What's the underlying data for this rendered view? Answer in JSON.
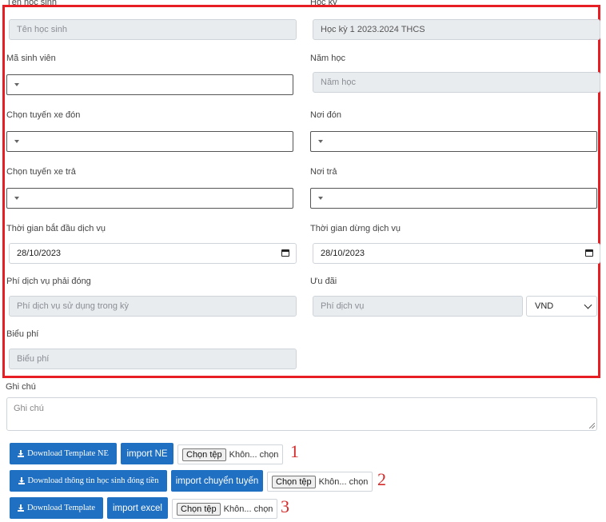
{
  "form": {
    "student_name": {
      "label": "Tên học sinh",
      "placeholder": "Tên học sinh"
    },
    "semester": {
      "label": "Học kỳ",
      "value": "Học kỳ 1 2023.2024 THCS"
    },
    "student_id": {
      "label": "Mã sinh viên"
    },
    "school_year": {
      "label": "Năm học",
      "placeholder": "Năm học"
    },
    "pickup_route": {
      "label": "Chọn tuyến xe đón"
    },
    "pickup_place": {
      "label": "Nơi đón"
    },
    "dropoff_route": {
      "label": "Chọn tuyến xe trả"
    },
    "dropoff_place": {
      "label": "Nơi trả"
    },
    "start_date": {
      "label": "Thời gian bắt đầu dịch vụ",
      "value": "28/10/2023"
    },
    "end_date": {
      "label": "Thời gian dừng dịch vụ",
      "value": "28/10/2023"
    },
    "fee": {
      "label": "Phí dịch vụ phải đóng",
      "placeholder": "Phí dịch vụ sử dụng  trong kỳ"
    },
    "discount": {
      "label": "Ưu đãi",
      "placeholder": "Phí dịch vụ",
      "currency": "VND"
    },
    "fee_schedule": {
      "label": "Biểu phí",
      "placeholder": "Biểu phí"
    }
  },
  "notes": {
    "label": "Ghi chú",
    "placeholder": "Ghi chú"
  },
  "actions": [
    {
      "download": "Download Template NE",
      "import": "import NE",
      "choose": "Chọn tệp",
      "file": "Khôn... chọn",
      "number": "1"
    },
    {
      "download": "Download thông tin học sinh đóng tiền",
      "import": "import chuyển tuyến",
      "choose": "Chọn tệp",
      "file": "Khôn... chọn",
      "number": "2"
    },
    {
      "download": "Download Template",
      "import": "import excel",
      "choose": "Chọn tệp",
      "file": "Khôn... chọn",
      "number": "3"
    }
  ],
  "colors": {
    "highlight_border": "#e81e25",
    "button": "#1f6fc2",
    "annotation": "#d42a2a"
  }
}
